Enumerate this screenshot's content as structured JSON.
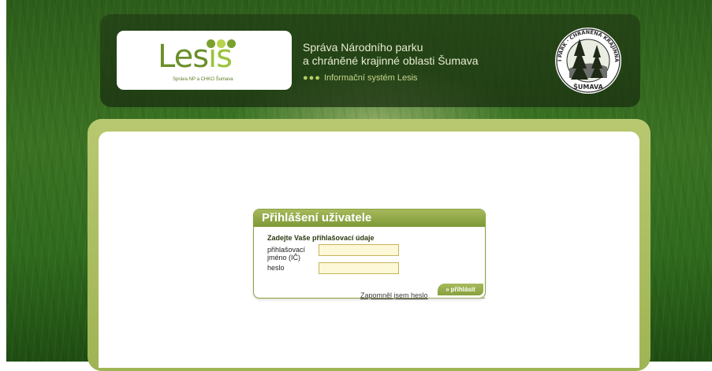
{
  "header": {
    "logo_word_main": "Les",
    "logo_word_accent": "is",
    "logo_subtitle": "Správa NP a CHKO Šumava",
    "logo_dots_colors": [
      "#7aa12d",
      "#b9d34d",
      "#7aa12d"
    ],
    "org_line1": "Správa Národního parku",
    "org_line2": "a chráněné krajinné oblasti Šumava",
    "system_dots": "●●●",
    "system_label": "Informační systém Lesis",
    "seal_text_left": "NÁRODNÍ PARK",
    "seal_text_right": "CHRÁNĚNÁ KRAJINNÁ OBLAST",
    "seal_text_bottom": "ŠUMAVA"
  },
  "login": {
    "title": "Přihlášení uživatele",
    "subtitle": "Zadejte Vaše přihlašovací údaje",
    "username_label_line1": "přihlašovací",
    "username_label_line2": "jméno (IČ)",
    "username_value": "",
    "password_label": "heslo",
    "password_value": "",
    "forgot_link": "Zapomněl jsem heslo",
    "submit_arrow": "»",
    "submit_label": "přihlásit"
  },
  "colors": {
    "brand_green": "#7d9836",
    "brand_light_green": "#a6b95c",
    "input_bg": "#fdf8d7",
    "input_border": "#c7b45a"
  }
}
